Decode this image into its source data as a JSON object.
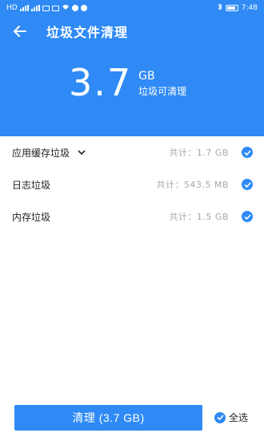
{
  "status_bar": {
    "time": "7:48",
    "left_text": "HD",
    "icons": [
      "sim-signal-icon",
      "wifi-icon",
      "notification-icon",
      "bluetooth-icon",
      "battery-icon"
    ]
  },
  "header": {
    "title": "垃圾文件清理",
    "size_value": "3.7",
    "size_unit": "GB",
    "size_caption": "垃圾可清理"
  },
  "items": [
    {
      "label": "应用缓存垃圾",
      "total": "共计：1.7 GB",
      "checked": true,
      "expandable": true
    },
    {
      "label": "日志垃圾",
      "total": "共计：543.5 MB",
      "checked": true,
      "expandable": false
    },
    {
      "label": "内存垃圾",
      "total": "共计：1.5 GB",
      "checked": true,
      "expandable": false
    }
  ],
  "footer": {
    "clean_button_label": "清理 (3.7 GB)",
    "select_all_label": "全选"
  },
  "colors": {
    "accent": "#2f8af5",
    "muted_text": "#a8a8a8"
  }
}
